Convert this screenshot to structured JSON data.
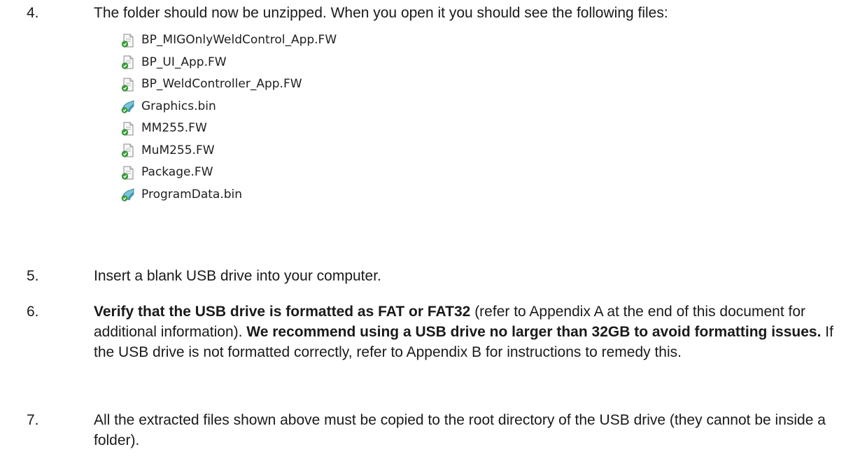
{
  "steps": [
    {
      "num": "4.",
      "text": "The folder should now be unzipped. When you open it you should see the following files:"
    },
    {
      "num": "5.",
      "text": "Insert a blank USB drive into your computer."
    },
    {
      "num": "6.",
      "bold1": "Verify that the USB drive is formatted as FAT or FAT32",
      "text1": " (refer to Appendix A at the end of this document for additional information). ",
      "bold2": "We recommend using a USB drive no larger than 32GB to avoid formatting issues.",
      "text2": " If the USB drive is not formatted correctly, refer to Appendix B for instructions to remedy this."
    },
    {
      "num": "7.",
      "text": "All the extracted files shown above must be copied to the root directory of the USB drive (they cannot be inside a folder)."
    }
  ],
  "files": [
    {
      "name": "BP_MIGOnlyWeldControl_App.FW",
      "icon": "fw-file-icon"
    },
    {
      "name": "BP_UI_App.FW",
      "icon": "fw-file-icon"
    },
    {
      "name": "BP_WeldController_App.FW",
      "icon": "fw-file-icon"
    },
    {
      "name": "Graphics.bin",
      "icon": "bin-file-icon"
    },
    {
      "name": "MM255.FW",
      "icon": "fw-file-icon"
    },
    {
      "name": "MuM255.FW",
      "icon": "fw-file-icon"
    },
    {
      "name": "Package.FW",
      "icon": "fw-file-icon"
    },
    {
      "name": "ProgramData.bin",
      "icon": "bin-file-icon"
    }
  ]
}
